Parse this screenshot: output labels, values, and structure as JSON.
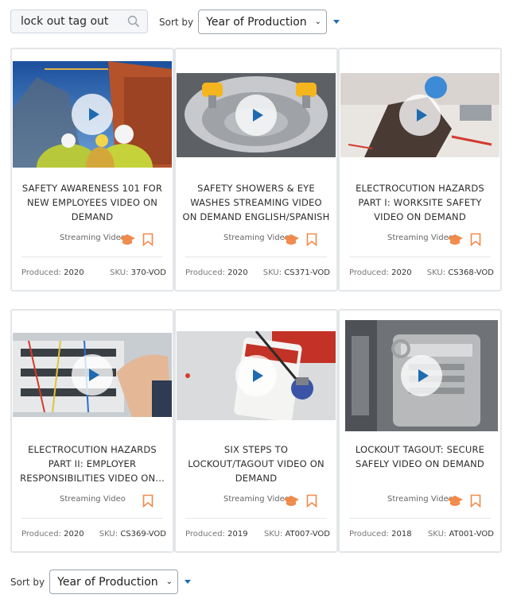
{
  "search": {
    "value": "lock out tag out",
    "icon": "search-icon"
  },
  "sort": {
    "label": "Sort by",
    "selected": "Year of Production"
  },
  "colors": {
    "accent": "#1f6bb0",
    "icon_orange": "#f08a4b"
  },
  "cards": [
    {
      "title": "SAFETY AWARENESS 101 FOR NEW EMPLOYEES VIDEO ON DEMAND",
      "format": "Streaming Video",
      "produced_label": "Produced:",
      "produced": "2020",
      "sku_label": "SKU:",
      "sku": "370-VOD",
      "has_cap": true
    },
    {
      "title": "SAFETY SHOWERS & EYE WASHES STREAMING VIDEO ON DEMAND ENGLISH/SPANISH",
      "format": "Streaming Video",
      "produced_label": "Produced:",
      "produced": "2020",
      "sku_label": "SKU:",
      "sku": "CS371-VOD",
      "has_cap": true
    },
    {
      "title": "ELECTROCUTION HAZARDS PART I: WORKSITE SAFETY VIDEO ON DEMAND",
      "format": "Streaming Video",
      "produced_label": "Produced:",
      "produced": "2020",
      "sku_label": "SKU:",
      "sku": "CS368-VOD",
      "has_cap": true
    },
    {
      "title": "ELECTROCUTION HAZARDS PART II: EMPLOYER RESPONSIBILITIES VIDEO ON...",
      "format": "Streaming Video",
      "produced_label": "Produced:",
      "produced": "2020",
      "sku_label": "SKU:",
      "sku": "CS369-VOD",
      "has_cap": false
    },
    {
      "title": "SIX STEPS TO LOCKOUT/TAGOUT VIDEO ON DEMAND",
      "format": "Streaming Video",
      "produced_label": "Produced:",
      "produced": "2019",
      "sku_label": "SKU:",
      "sku": "AT007-VOD",
      "has_cap": true
    },
    {
      "title": "LOCKOUT TAGOUT: SECURE SAFELY VIDEO ON DEMAND",
      "format": "Streaming Video",
      "produced_label": "Produced:",
      "produced": "2018",
      "sku_label": "SKU:",
      "sku": "AT001-VOD",
      "has_cap": true
    }
  ]
}
